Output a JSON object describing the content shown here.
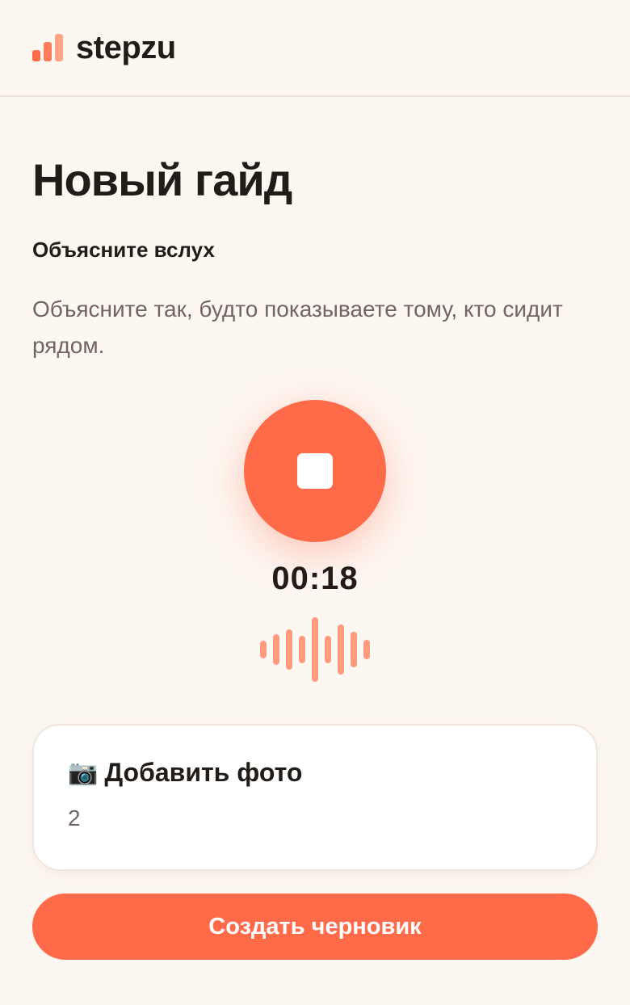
{
  "header": {
    "brand": "stepzu",
    "logo_icon": "bar-chart-icon"
  },
  "page": {
    "title": "Новый гайд",
    "subtitle": "Объясните вслух",
    "description": "Объясните так, будто показываете тому, кто сидит рядом."
  },
  "recorder": {
    "icon": "stop-icon",
    "timer": "00:18",
    "accent_color": "#ff6a48",
    "waveform_icon": "waveform-icon"
  },
  "photo_card": {
    "icon": "📷",
    "label": "Добавить фото",
    "count": "2"
  },
  "actions": {
    "create_draft": "Создать черновик"
  }
}
